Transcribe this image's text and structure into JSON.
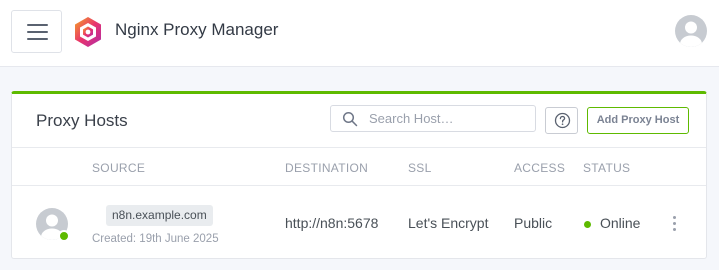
{
  "header": {
    "app_title": "Nginx Proxy Manager",
    "menu_icon": "hamburger-menu-icon",
    "logo_icon": "nginx-proxy-manager-logo",
    "user_icon": "user-avatar-icon"
  },
  "card": {
    "title": "Proxy Hosts",
    "accent_color": "#5eba00",
    "search": {
      "placeholder": "Search Host…",
      "value": ""
    },
    "help_icon": "question-circle-icon",
    "add_button_label": "Add Proxy Host",
    "columns": [
      "SOURCE",
      "DESTINATION",
      "SSL",
      "ACCESS",
      "STATUS"
    ],
    "rows": [
      {
        "source_domain": "n8n.example.com",
        "created": "Created: 19th June 2025",
        "destination": "http://n8n:5678",
        "ssl": "Let's Encrypt",
        "access": "Public",
        "status": "Online",
        "status_color": "#5eba00",
        "actions_icon": "more-vertical-icon"
      }
    ]
  }
}
